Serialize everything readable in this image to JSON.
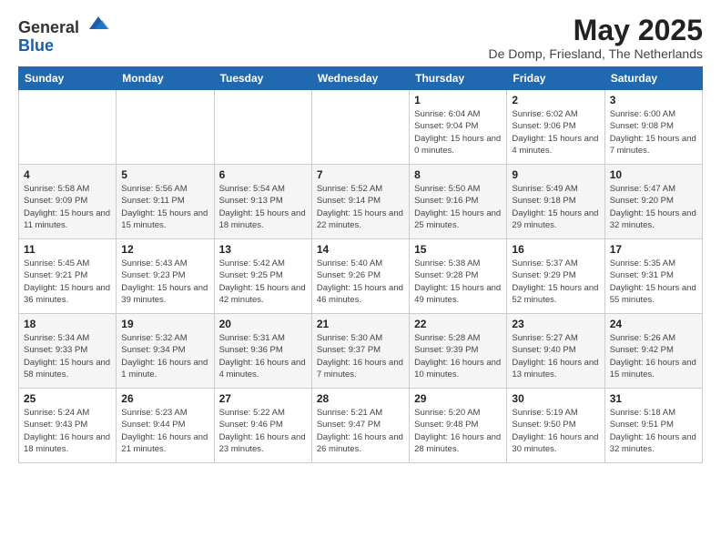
{
  "logo": {
    "general": "General",
    "blue": "Blue"
  },
  "title": "May 2025",
  "location": "De Domp, Friesland, The Netherlands",
  "days_of_week": [
    "Sunday",
    "Monday",
    "Tuesday",
    "Wednesday",
    "Thursday",
    "Friday",
    "Saturday"
  ],
  "weeks": [
    [
      {
        "day": "",
        "info": ""
      },
      {
        "day": "",
        "info": ""
      },
      {
        "day": "",
        "info": ""
      },
      {
        "day": "",
        "info": ""
      },
      {
        "day": "1",
        "info": "Sunrise: 6:04 AM\nSunset: 9:04 PM\nDaylight: 15 hours and 0 minutes."
      },
      {
        "day": "2",
        "info": "Sunrise: 6:02 AM\nSunset: 9:06 PM\nDaylight: 15 hours and 4 minutes."
      },
      {
        "day": "3",
        "info": "Sunrise: 6:00 AM\nSunset: 9:08 PM\nDaylight: 15 hours and 7 minutes."
      }
    ],
    [
      {
        "day": "4",
        "info": "Sunrise: 5:58 AM\nSunset: 9:09 PM\nDaylight: 15 hours and 11 minutes."
      },
      {
        "day": "5",
        "info": "Sunrise: 5:56 AM\nSunset: 9:11 PM\nDaylight: 15 hours and 15 minutes."
      },
      {
        "day": "6",
        "info": "Sunrise: 5:54 AM\nSunset: 9:13 PM\nDaylight: 15 hours and 18 minutes."
      },
      {
        "day": "7",
        "info": "Sunrise: 5:52 AM\nSunset: 9:14 PM\nDaylight: 15 hours and 22 minutes."
      },
      {
        "day": "8",
        "info": "Sunrise: 5:50 AM\nSunset: 9:16 PM\nDaylight: 15 hours and 25 minutes."
      },
      {
        "day": "9",
        "info": "Sunrise: 5:49 AM\nSunset: 9:18 PM\nDaylight: 15 hours and 29 minutes."
      },
      {
        "day": "10",
        "info": "Sunrise: 5:47 AM\nSunset: 9:20 PM\nDaylight: 15 hours and 32 minutes."
      }
    ],
    [
      {
        "day": "11",
        "info": "Sunrise: 5:45 AM\nSunset: 9:21 PM\nDaylight: 15 hours and 36 minutes."
      },
      {
        "day": "12",
        "info": "Sunrise: 5:43 AM\nSunset: 9:23 PM\nDaylight: 15 hours and 39 minutes."
      },
      {
        "day": "13",
        "info": "Sunrise: 5:42 AM\nSunset: 9:25 PM\nDaylight: 15 hours and 42 minutes."
      },
      {
        "day": "14",
        "info": "Sunrise: 5:40 AM\nSunset: 9:26 PM\nDaylight: 15 hours and 46 minutes."
      },
      {
        "day": "15",
        "info": "Sunrise: 5:38 AM\nSunset: 9:28 PM\nDaylight: 15 hours and 49 minutes."
      },
      {
        "day": "16",
        "info": "Sunrise: 5:37 AM\nSunset: 9:29 PM\nDaylight: 15 hours and 52 minutes."
      },
      {
        "day": "17",
        "info": "Sunrise: 5:35 AM\nSunset: 9:31 PM\nDaylight: 15 hours and 55 minutes."
      }
    ],
    [
      {
        "day": "18",
        "info": "Sunrise: 5:34 AM\nSunset: 9:33 PM\nDaylight: 15 hours and 58 minutes."
      },
      {
        "day": "19",
        "info": "Sunrise: 5:32 AM\nSunset: 9:34 PM\nDaylight: 16 hours and 1 minute."
      },
      {
        "day": "20",
        "info": "Sunrise: 5:31 AM\nSunset: 9:36 PM\nDaylight: 16 hours and 4 minutes."
      },
      {
        "day": "21",
        "info": "Sunrise: 5:30 AM\nSunset: 9:37 PM\nDaylight: 16 hours and 7 minutes."
      },
      {
        "day": "22",
        "info": "Sunrise: 5:28 AM\nSunset: 9:39 PM\nDaylight: 16 hours and 10 minutes."
      },
      {
        "day": "23",
        "info": "Sunrise: 5:27 AM\nSunset: 9:40 PM\nDaylight: 16 hours and 13 minutes."
      },
      {
        "day": "24",
        "info": "Sunrise: 5:26 AM\nSunset: 9:42 PM\nDaylight: 16 hours and 15 minutes."
      }
    ],
    [
      {
        "day": "25",
        "info": "Sunrise: 5:24 AM\nSunset: 9:43 PM\nDaylight: 16 hours and 18 minutes."
      },
      {
        "day": "26",
        "info": "Sunrise: 5:23 AM\nSunset: 9:44 PM\nDaylight: 16 hours and 21 minutes."
      },
      {
        "day": "27",
        "info": "Sunrise: 5:22 AM\nSunset: 9:46 PM\nDaylight: 16 hours and 23 minutes."
      },
      {
        "day": "28",
        "info": "Sunrise: 5:21 AM\nSunset: 9:47 PM\nDaylight: 16 hours and 26 minutes."
      },
      {
        "day": "29",
        "info": "Sunrise: 5:20 AM\nSunset: 9:48 PM\nDaylight: 16 hours and 28 minutes."
      },
      {
        "day": "30",
        "info": "Sunrise: 5:19 AM\nSunset: 9:50 PM\nDaylight: 16 hours and 30 minutes."
      },
      {
        "day": "31",
        "info": "Sunrise: 5:18 AM\nSunset: 9:51 PM\nDaylight: 16 hours and 32 minutes."
      }
    ]
  ]
}
